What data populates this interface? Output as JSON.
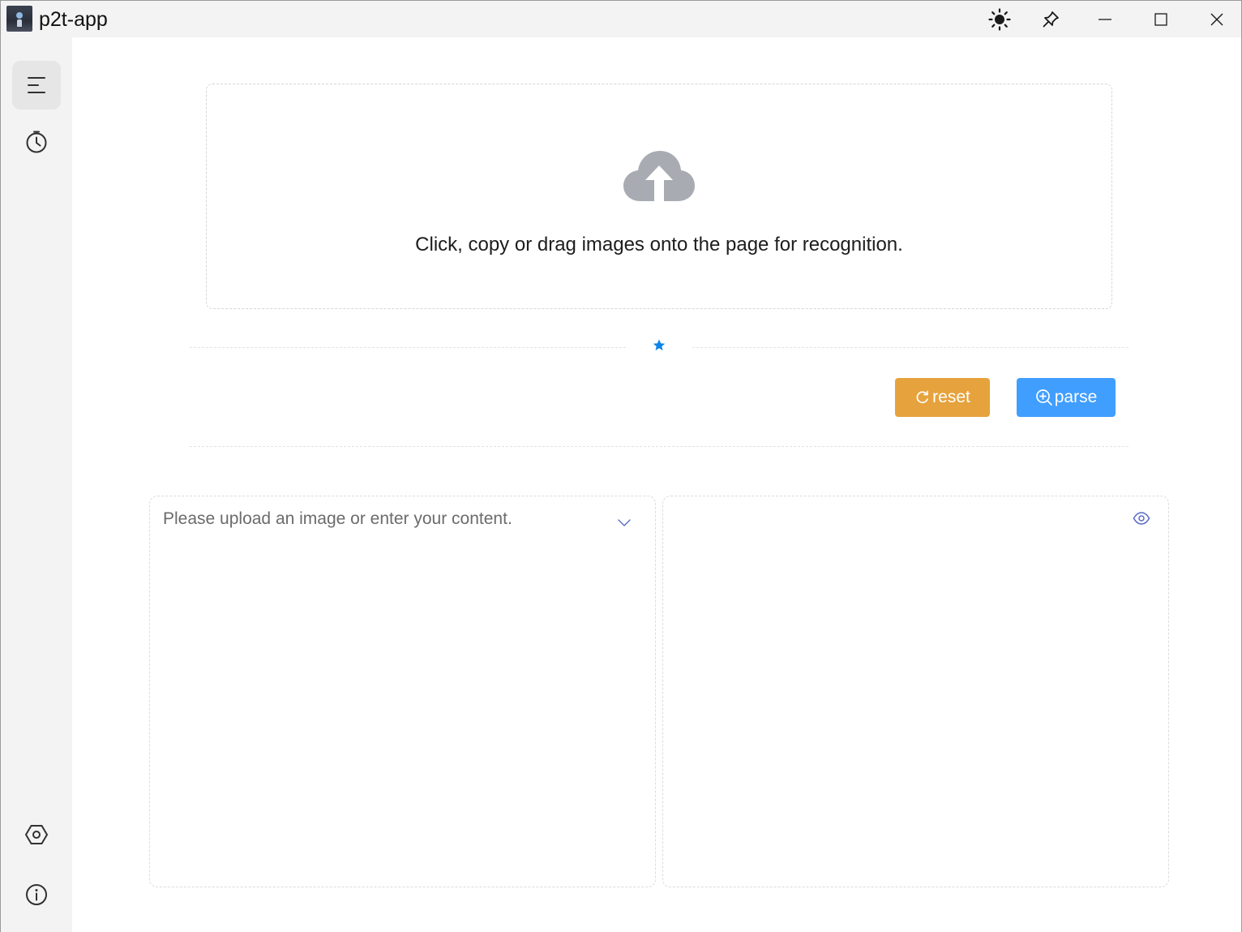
{
  "titlebar": {
    "app_name": "p2t-app",
    "icons": [
      "theme-sun-icon",
      "pin-icon",
      "minimize-icon",
      "maximize-icon",
      "close-icon"
    ]
  },
  "sidebar": {
    "items": [
      {
        "name": "menu",
        "icon": "menu-lines-icon",
        "active": true
      },
      {
        "name": "history",
        "icon": "clock-icon",
        "active": false
      },
      {
        "name": "settings",
        "icon": "hexagon-settings-icon",
        "active": false
      },
      {
        "name": "about",
        "icon": "info-icon",
        "active": false
      }
    ]
  },
  "upload": {
    "text": "Click, copy or drag images onto the page for recognition.",
    "icon": "cloud-upload-icon"
  },
  "actions": {
    "reset_label": "reset",
    "parse_label": "parse"
  },
  "editor": {
    "placeholder": "Please upload an image or enter your content."
  },
  "colors": {
    "reset": "#e6a23c",
    "parse": "#409eff",
    "accent_star": "#0a84e8",
    "icon_gray": "#a8abb2"
  }
}
